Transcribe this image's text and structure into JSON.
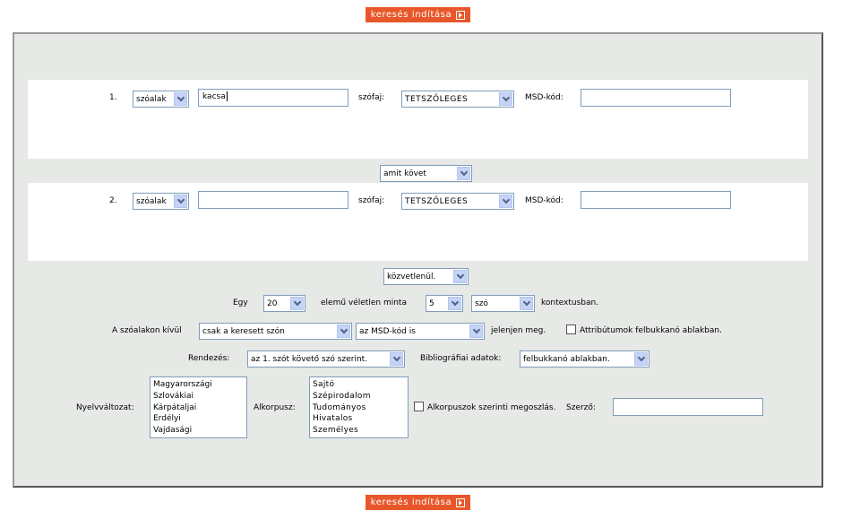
{
  "search_button_label": "keresés indítása",
  "rows": [
    {
      "number": "1.",
      "form_select": "szóalak",
      "query_value": "kacsa",
      "pos_label": "szófaj:",
      "pos_select": "TETSZŐLEGES",
      "msd_label": "MSD-kód:",
      "msd_value": ""
    },
    {
      "number": "2.",
      "form_select": "szóalak",
      "query_value": "",
      "pos_label": "szófaj:",
      "pos_select": "TETSZŐLEGES",
      "msd_label": "MSD-kód:",
      "msd_value": ""
    }
  ],
  "relation_select": "amit követ",
  "distance_select": "közvetlenül.",
  "sample": {
    "prefix": "Egy",
    "count_select": "20",
    "middle": "elemű véletlen minta",
    "context_count_select": "5",
    "context_unit_select": "szó",
    "suffix": "kontextusban."
  },
  "display": {
    "label": "A szóalakon kívül",
    "what_select": "csak a keresett szón",
    "msd_select": "az MSD-kód is",
    "suffix": "jelenjen meg.",
    "attributes_checkbox_label": "Attribútumok felbukkanó ablakban.",
    "attributes_checked": false
  },
  "sorting": {
    "label": "Rendezés:",
    "select": "az 1. szót követő szó szerint.",
    "biblio_label": "Bibliográfiai adatok:",
    "biblio_select": "felbukkanó ablakban."
  },
  "variants": {
    "label": "Nyelvváltozat:",
    "options": [
      "Magyarországi",
      "Szlovákiai",
      "Kárpátaljai",
      "Erdélyi",
      "Vajdasági"
    ]
  },
  "subcorpus": {
    "label": "Alkorpusz:",
    "options": [
      "Sajtó",
      "Szépirodalom",
      "Tudományos",
      "Hivatalos",
      "Személyes"
    ],
    "distribution_label": "Alkorpuszok szerinti megoszlás.",
    "distribution_checked": false
  },
  "author": {
    "label": "Szerző:",
    "value": ""
  }
}
